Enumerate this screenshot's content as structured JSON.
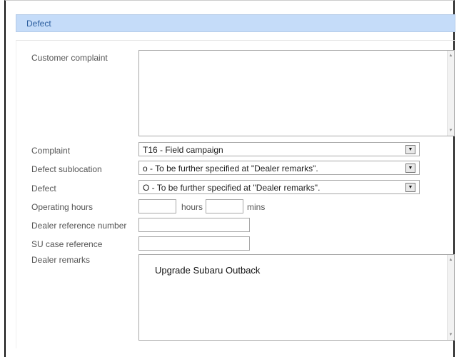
{
  "section": {
    "title": "Defect"
  },
  "fields": {
    "customer_complaint": {
      "label": "Customer complaint",
      "value": ""
    },
    "complaint": {
      "label": "Complaint",
      "selected": "T16 - Field campaign"
    },
    "defect_sublocation": {
      "label": "Defect sublocation",
      "selected": "o - To be further specified at \"Dealer remarks\"."
    },
    "defect": {
      "label": "Defect",
      "selected": "O - To be further specified at \"Dealer remarks\"."
    },
    "operating_hours": {
      "label": "Operating hours",
      "hours_value": "",
      "hours_unit": "hours",
      "mins_value": "",
      "mins_unit": "mins"
    },
    "dealer_reference_number": {
      "label": "Dealer reference number",
      "value": ""
    },
    "su_case_reference": {
      "label": "SU case reference",
      "value": ""
    },
    "dealer_remarks": {
      "label": "Dealer remarks",
      "value": "Upgrade Subaru Outback"
    }
  },
  "icons": {
    "dropdown": "chevron-down-icon",
    "scroll_up": "scroll-up-icon",
    "scroll_down": "scroll-down-icon"
  },
  "colors": {
    "header_bg": "#c5dcf9",
    "header_text": "#2b5d9e",
    "label_text": "#555555"
  }
}
